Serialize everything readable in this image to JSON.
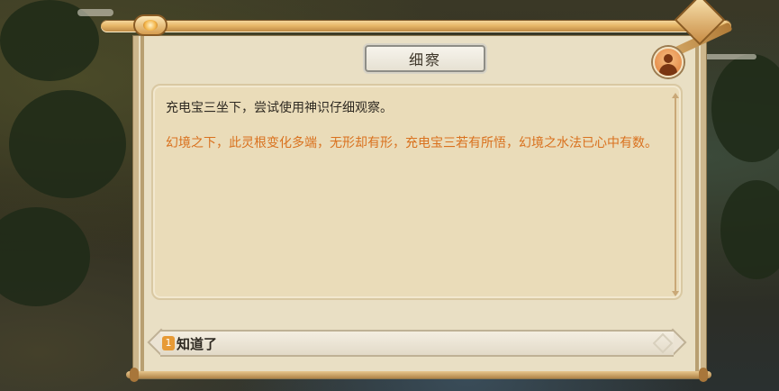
{
  "dialog": {
    "title": "细察",
    "avatar_icon": "person-icon",
    "text_line1": "充电宝三坐下，尝试使用神识仔细观察。",
    "text_line2": "幻境之下，此灵根变化多端，无形却有形，充电宝三若有所悟，幻境之水法已心中有数。",
    "text_line2_color": "#d9711e"
  },
  "choices": [
    {
      "number": "1",
      "label": "知道了"
    }
  ]
}
